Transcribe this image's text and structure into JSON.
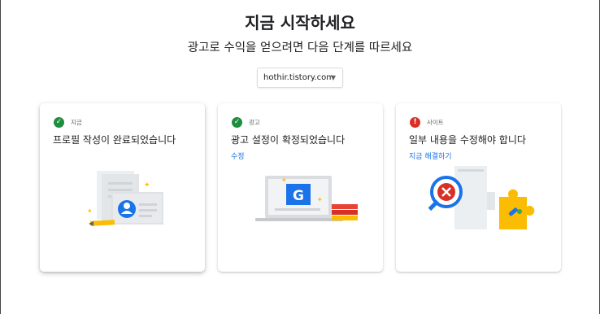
{
  "page": {
    "title": "지금 시작하세요",
    "subtitle": "광고로 수익을 얻으려면 다음 단계를 따르세요"
  },
  "site_selector": {
    "value": "hothir.tistory.com"
  },
  "cards": [
    {
      "status": "ok",
      "category": "지금",
      "title": "프로필 작성이 완료되었습니다",
      "link": ""
    },
    {
      "status": "ok",
      "category": "광고",
      "title": "광고 설정이 확정되었습니다",
      "link": "수정"
    },
    {
      "status": "error",
      "category": "사이트",
      "title": "일부 내용을 수정해야 합니다",
      "link": "지금 해결하기"
    }
  ],
  "colors": {
    "success": "#1e8e3e",
    "error": "#d93025",
    "link": "#1a73e8",
    "google_blue": "#1a73e8",
    "accent_yellow": "#fbbc04"
  }
}
